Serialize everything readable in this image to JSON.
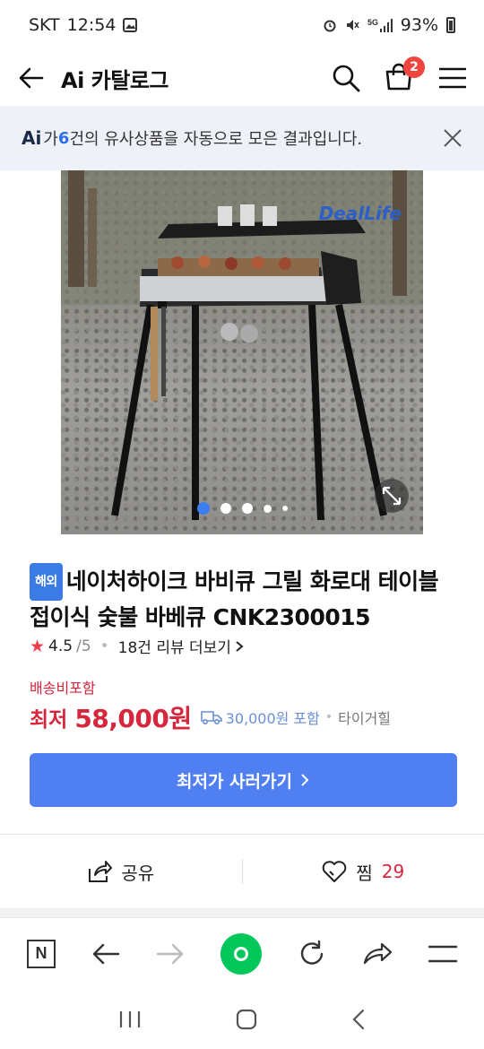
{
  "status_bar": {
    "carrier": "SKT",
    "time": "12:54",
    "battery": "93%"
  },
  "header": {
    "title": "Ai 카탈로그",
    "cart_count": "2"
  },
  "ai_banner": {
    "logo": "Ai",
    "prefix": "가 ",
    "count": "6",
    "suffix": "건의 유사상품을 자동으로 모은 결과입니다."
  },
  "photo": {
    "watermark": "DealLife",
    "slide_count": 5,
    "active_slide": 1
  },
  "product": {
    "tag": "해외",
    "name": "네이처하이크 바비큐 그릴 화로대 테이블 접이식 숯불 바베큐 CNK2300015",
    "rating": "4.5",
    "rating_max": "/5",
    "review_text": "18건 리뷰 더보기",
    "shipping_note": "배송비포함",
    "price_label": "최저",
    "price": "58,000원",
    "delivery_price": "30,000원 포함",
    "mall": "타이거힐"
  },
  "cta": {
    "label": "최저가 사러가기"
  },
  "actions": {
    "share_label": "공유",
    "wish_label": "찜",
    "wish_count": "29"
  },
  "colors": {
    "accent": "#4f7ff0",
    "price": "#d6273d",
    "naver_green": "#03c75a"
  }
}
